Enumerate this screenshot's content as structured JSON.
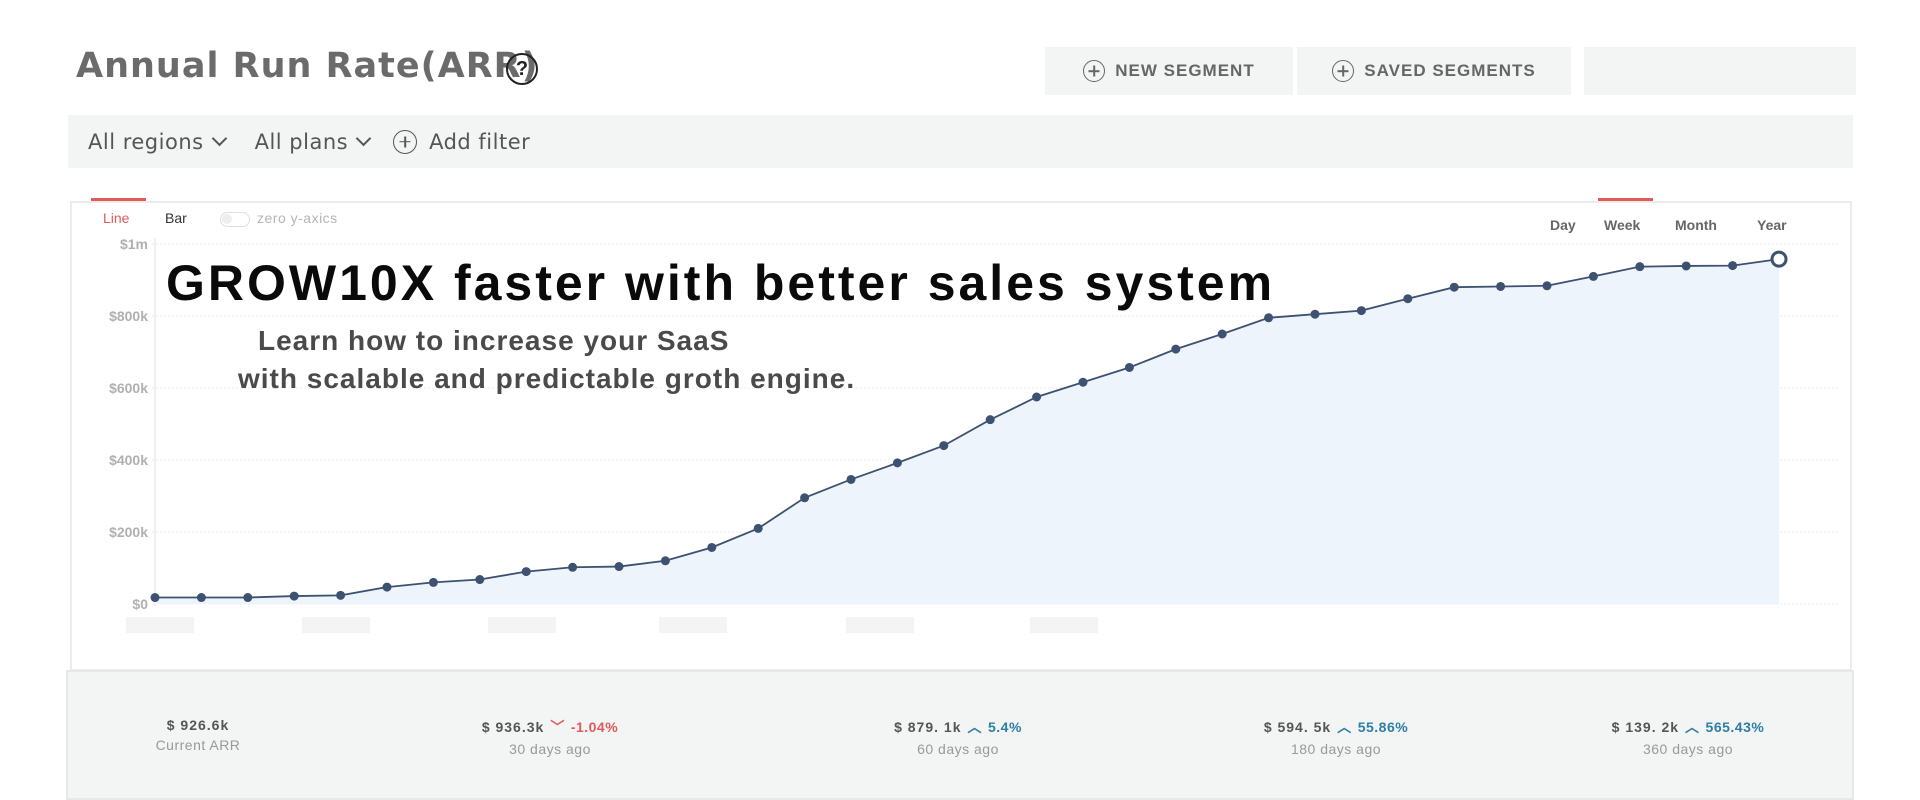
{
  "header": {
    "title": "Annual Run Rate(ARR)",
    "help_icon": "question-circle-icon",
    "new_segment_label": "NEW SEGMENT",
    "saved_segments_label": "SAVED SEGMENTS"
  },
  "filters": {
    "region_label": "All regions",
    "plan_label": "All plans",
    "add_filter_label": "Add filter"
  },
  "chart_controls": {
    "line_tab": "Line",
    "bar_tab": "Bar",
    "zero_axis_label": "zero y-axics",
    "active_chart_tab": "Line",
    "periods": [
      "Day",
      "Week",
      "Month",
      "Year"
    ],
    "active_period": "Week"
  },
  "promo": {
    "title": "GROW10X faster with better sales system",
    "subtitle_line1": "Learn how to increase your SaaS",
    "subtitle_line2": "with scalable and predictable groth engine."
  },
  "chart_data": {
    "type": "area",
    "title": "",
    "xlabel": "",
    "ylabel": "",
    "ylim": [
      0,
      1000000
    ],
    "y_ticks": [
      0,
      200000,
      400000,
      600000,
      800000,
      1000000
    ],
    "y_tick_labels": [
      "$0",
      "$200k",
      "$400k",
      "$600k",
      "$800k",
      "$1m"
    ],
    "grid": true,
    "series": [
      {
        "values": [
          18000,
          18000,
          18000,
          22000,
          24000,
          47000,
          60000,
          68000,
          90000,
          102000,
          104000,
          120000,
          157000,
          210000,
          295000,
          346000,
          392000,
          440000,
          512000,
          575000,
          616000,
          657000,
          708000,
          750000,
          795000,
          805000,
          815000,
          848000,
          880000,
          882000,
          884000,
          910000,
          937000,
          939000,
          940000,
          958000
        ]
      }
    ],
    "colors": {
      "line": "#3d5170",
      "fill": "#eef4fb"
    }
  },
  "stats": [
    {
      "value": "$ 926.6k",
      "caption": "Current ARR",
      "change": "",
      "direction": ""
    },
    {
      "value": "$ 936.3k",
      "caption": "30 days ago",
      "change": "-1.04%",
      "direction": "down"
    },
    {
      "value": "$ 879. 1k",
      "caption": "60 days ago",
      "change": "5.4%",
      "direction": "up"
    },
    {
      "value": "$ 594. 5k",
      "caption": "180 days ago",
      "change": "55.86%",
      "direction": "up"
    },
    {
      "value": "$ 139. 2k",
      "caption": "360 days ago",
      "change": "565.43%",
      "direction": "up"
    }
  ],
  "colors": {
    "accent": "#e05a5a",
    "up": "#2e7fa7",
    "down": "#e05a5a"
  }
}
